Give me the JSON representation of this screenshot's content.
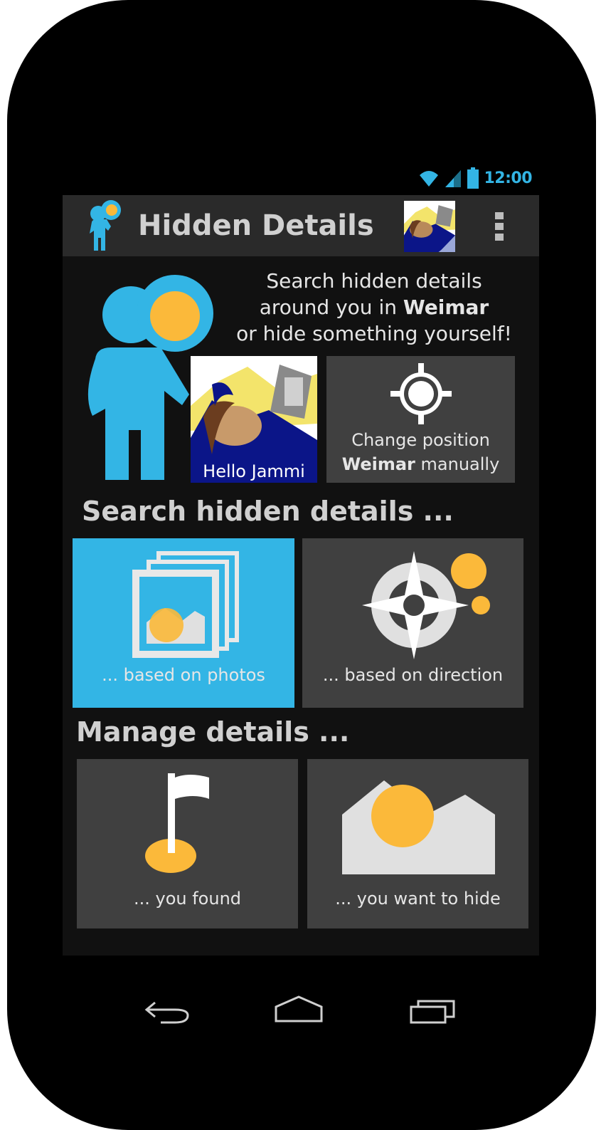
{
  "statusbar": {
    "time": "12:00"
  },
  "actionbar": {
    "title": "Hidden Details",
    "app_icon": "mascot-binoculars-icon",
    "avatar": "user-avatar",
    "menu_icon": "overflow-menu-icon"
  },
  "intro": {
    "line1": "Search hidden details",
    "line2_prefix": "around you in ",
    "line2_city": "Weimar",
    "line3": "or hide something yourself!"
  },
  "hello_tile": {
    "label": "Hello Jammi"
  },
  "change_position": {
    "line1": "Change position",
    "line2_city": "Weimar",
    "line2_suffix": " manually",
    "icon": "crosshair-location-icon"
  },
  "search_section": {
    "title": "Search hidden details ...",
    "tiles": [
      {
        "label": "... based on photos",
        "icon": "photo-stack-icon"
      },
      {
        "label": "... based on direction",
        "icon": "compass-icon"
      }
    ]
  },
  "manage_section": {
    "title": "Manage details ...",
    "tiles": [
      {
        "label": "... you found",
        "icon": "flag-icon"
      },
      {
        "label": "... you want to hide",
        "icon": "landscape-icon"
      }
    ]
  },
  "navbar": {
    "back": "back-icon",
    "home": "home-icon",
    "recents": "recents-icon"
  },
  "colors": {
    "accent": "#33b5e5",
    "highlight": "#fbb93a",
    "tile": "#404040",
    "background": "#111111"
  }
}
